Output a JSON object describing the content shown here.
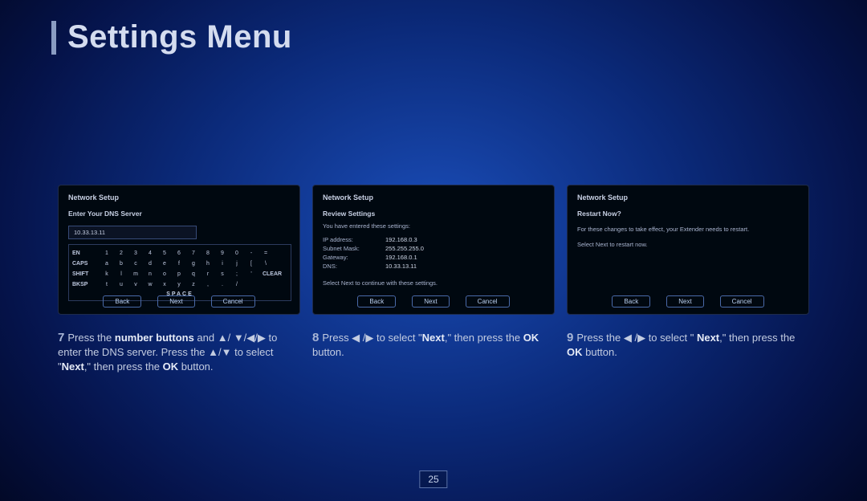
{
  "page_title": "Settings Menu",
  "page_number": "25",
  "panel1": {
    "header": "Network Setup",
    "sub": "Enter Your DNS Server",
    "dns_value": "10.33.13.11",
    "kb": {
      "r1_label": "EN",
      "r1": [
        "1",
        "2",
        "3",
        "4",
        "5",
        "6",
        "7",
        "8",
        "9",
        "0",
        "-",
        "="
      ],
      "r2_label": "CAPS",
      "r2": [
        "a",
        "b",
        "c",
        "d",
        "e",
        "f",
        "g",
        "h",
        "i",
        "j",
        "[",
        "\\"
      ],
      "r3_label": "SHIFT",
      "r3": [
        "k",
        "l",
        "m",
        "n",
        "o",
        "p",
        "q",
        "r",
        "s",
        ";",
        "'"
      ],
      "r3_end": "CLEAR",
      "r4_label": "BKSP",
      "r4": [
        "t",
        "u",
        "v",
        "w",
        "x",
        "y",
        "z",
        ",",
        ".",
        "/"
      ],
      "space": "SPACE"
    }
  },
  "panel2": {
    "header": "Network Setup",
    "sub": "Review Settings",
    "line": "You have entered these settings:",
    "ip_k": "IP address:",
    "ip_v": "192.168.0.3",
    "mask_k": "Subnet Mask:",
    "mask_v": "255.255.255.0",
    "gw_k": "Gateway:",
    "gw_v": "192.168.0.1",
    "dns_k": "DNS:",
    "dns_v": "10.33.13.11",
    "foot": "Select Next to continue with these settings."
  },
  "panel3": {
    "header": "Network Setup",
    "sub": "Restart Now?",
    "line1": "For these changes to take effect, your Extender needs to restart.",
    "line2": "Select Next to restart now."
  },
  "buttons": {
    "back": "Back",
    "next": "Next",
    "cancel": "Cancel"
  },
  "cap7": {
    "num": "7",
    "a": "Press the ",
    "b": "number buttons",
    "c": " and ▲/ ▼/◀/▶ to enter the DNS server. Press the ▲/▼ to select \"",
    "d": "Next",
    "e": ",\" then press the ",
    "f": "OK",
    "g": " button."
  },
  "cap8": {
    "num": "8",
    "a": "Press ◀ /▶ to select \"",
    "b": "Next",
    "c": ",\" then press the ",
    "d": "OK",
    "e": " button."
  },
  "cap9": {
    "num": "9",
    "a": "Press the ◀ /▶ to select \" ",
    "b": "Next",
    "c": ",\" then press the ",
    "d": "OK",
    "e": " button."
  }
}
